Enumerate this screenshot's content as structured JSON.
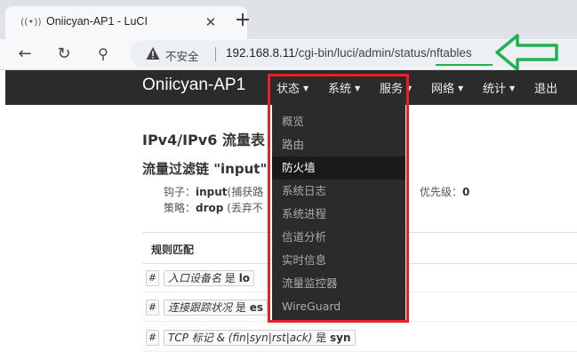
{
  "browser": {
    "tab_title": "Oniicyan-AP1 - LuCI",
    "close_glyph": "✕",
    "new_tab_glyph": "+",
    "back_glyph": "←",
    "reload_glyph": "↻",
    "search_glyph": "⚲",
    "insecure_label": "不安全",
    "url_host": "192.168.8.11",
    "url_path": "/cgi-bin/luci/admin/status/nftables"
  },
  "header": {
    "brand": "Oniicyan-AP1",
    "menu": [
      {
        "label": "状态",
        "caret": "▼"
      },
      {
        "label": "系统",
        "caret": "▼"
      },
      {
        "label": "服务",
        "caret": "▼"
      },
      {
        "label": "网络",
        "caret": "▼"
      },
      {
        "label": "统计",
        "caret": "▼"
      },
      {
        "label": "退出",
        "caret": ""
      }
    ]
  },
  "dropdown": {
    "items": [
      {
        "label": "概览"
      },
      {
        "label": "路由"
      },
      {
        "label": "防火墙"
      },
      {
        "label": "系统日志"
      },
      {
        "label": "系统进程"
      },
      {
        "label": "信道分析"
      },
      {
        "label": "实时信息"
      },
      {
        "label": "流量监控器"
      },
      {
        "label": "WireGuard"
      }
    ],
    "active_index": 2
  },
  "page": {
    "title": "IPv4/IPv6 流量表",
    "chain_title": "流量过滤链 \"input\"",
    "hook_label": "钩子：",
    "hook_value": "input",
    "hook_note": "(捕获路",
    "policy_label": "策略：",
    "policy_value": "drop",
    "policy_note": "(丢弃不",
    "priority_label": "优先级：",
    "priority_value": "0",
    "table_header": "规则匹配",
    "rows": [
      {
        "hash": "#",
        "field": "入口设备名",
        "op": "是",
        "value": "lo"
      },
      {
        "hash": "#",
        "field": "连接跟踪状况",
        "op": "是",
        "value": "es"
      },
      {
        "hash": "#",
        "field": "TCP 标记 & (fin|syn|rst|ack)",
        "op": "是",
        "value": "syn"
      }
    ]
  },
  "colors": {
    "header_bg": "#2b2b2b",
    "highlight_red": "#e8202a",
    "arrow_green": "#22b14c"
  }
}
